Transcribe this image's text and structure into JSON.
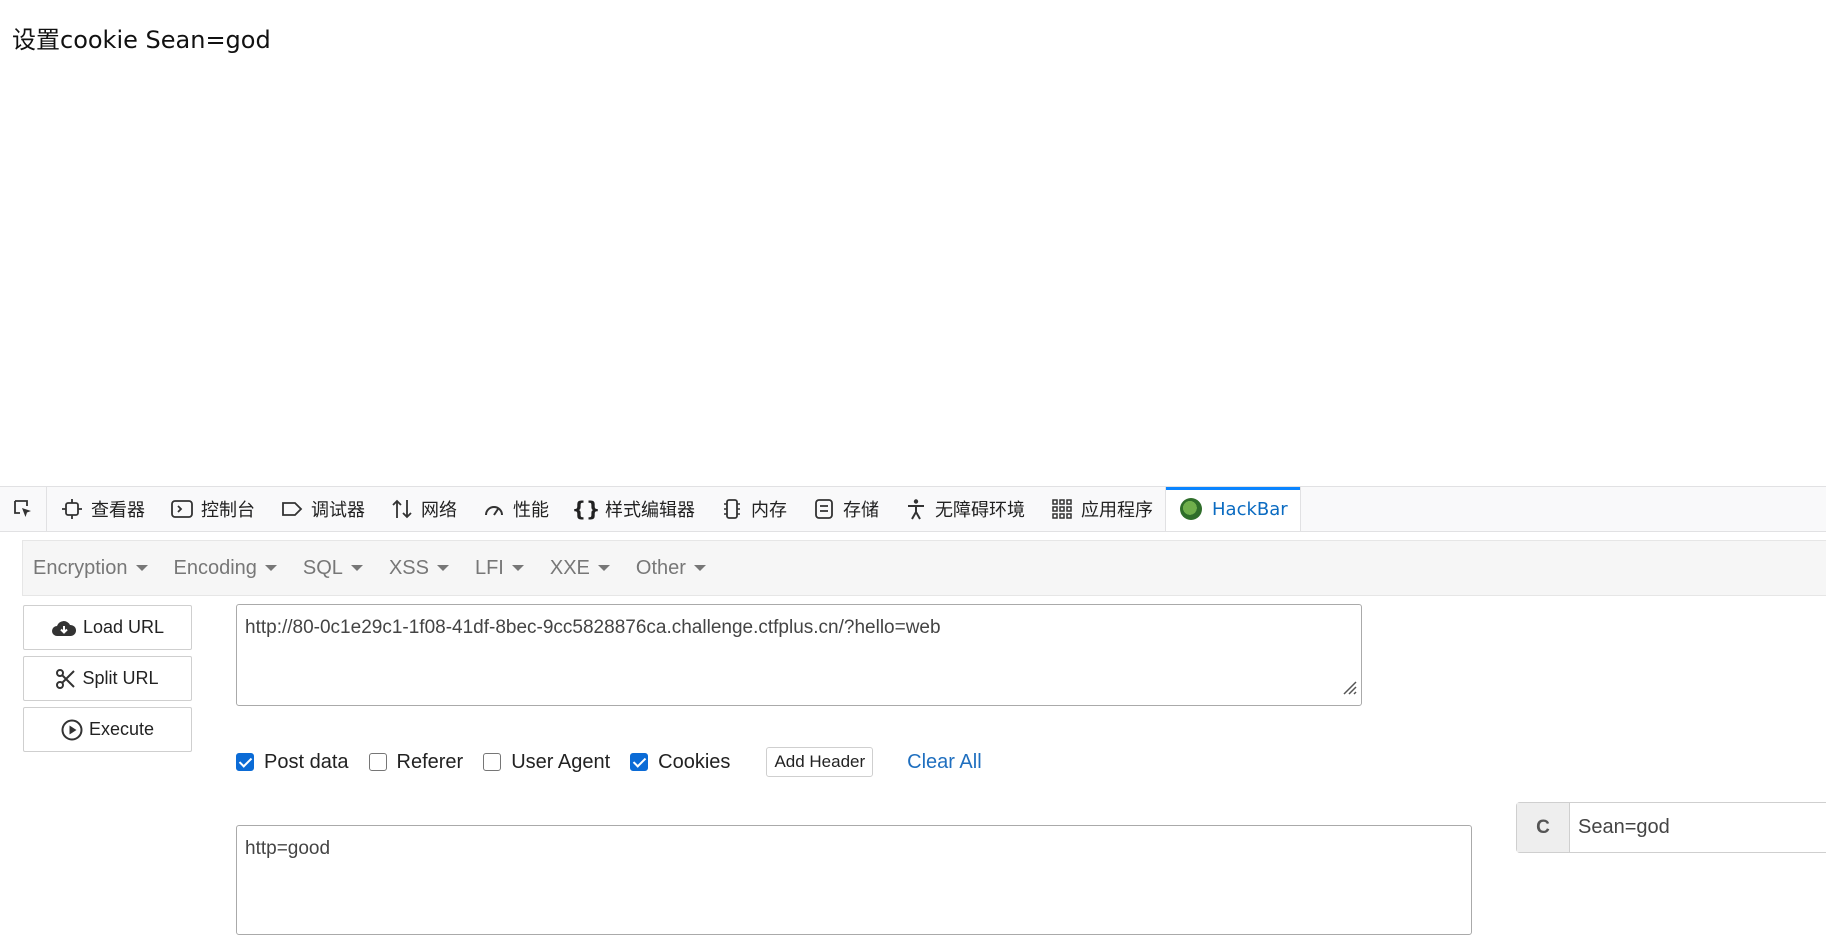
{
  "page": {
    "text": "设置cookie Sean=god"
  },
  "devtools": {
    "tabs": [
      {
        "label": "查看器",
        "icon": "inspector-icon"
      },
      {
        "label": "控制台",
        "icon": "console-icon"
      },
      {
        "label": "调试器",
        "icon": "debugger-icon"
      },
      {
        "label": "网络",
        "icon": "network-icon"
      },
      {
        "label": "性能",
        "icon": "performance-icon"
      },
      {
        "label": "样式编辑器",
        "icon": "style-editor-icon"
      },
      {
        "label": "内存",
        "icon": "memory-icon"
      },
      {
        "label": "存储",
        "icon": "storage-icon"
      },
      {
        "label": "无障碍环境",
        "icon": "accessibility-icon"
      },
      {
        "label": "应用程序",
        "icon": "application-icon"
      },
      {
        "label": "HackBar",
        "icon": "hackbar-icon",
        "active": true
      }
    ]
  },
  "hackbar": {
    "menu": [
      "Encryption",
      "Encoding",
      "SQL",
      "XSS",
      "LFI",
      "XXE",
      "Other"
    ],
    "buttons": {
      "load_url": "Load URL",
      "split_url": "Split URL",
      "execute": "Execute"
    },
    "url": "http://80-0c1e29c1-1f08-41df-8bec-9cc5828876ca.challenge.ctfplus.cn/?hello=web",
    "options": {
      "post_data": {
        "label": "Post data",
        "checked": true
      },
      "referer": {
        "label": "Referer",
        "checked": false
      },
      "user_agent": {
        "label": "User Agent",
        "checked": false
      },
      "cookies": {
        "label": "Cookies",
        "checked": true
      }
    },
    "add_header": "Add Header",
    "clear_all": "Clear All",
    "post_body": "http=good",
    "cookie": {
      "addon": "C",
      "value": "Sean=god"
    }
  },
  "colors": {
    "accent": "#0a84ff",
    "link": "#1f6fbf",
    "checkbox": "#0b6bd6"
  }
}
